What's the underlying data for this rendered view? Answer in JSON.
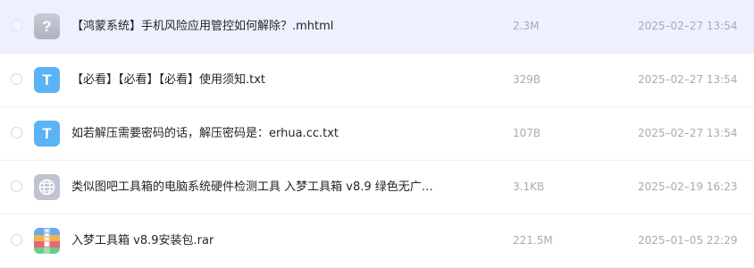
{
  "files": [
    {
      "icon": "unknown-file-icon",
      "icon_glyph": "?",
      "name": "【鸿蒙系统】手机风险应用管控如何解除？.mhtml",
      "size": "2.3M",
      "date": "2025–02–27 13:54",
      "selected": true
    },
    {
      "icon": "txt-file-icon",
      "icon_glyph": "T",
      "name": "【必看】【必看】【必看】使用须知.txt",
      "size": "329B",
      "date": "2025–02–27 13:54",
      "selected": false
    },
    {
      "icon": "txt-file-icon",
      "icon_glyph": "T",
      "name": "如若解压需要密码的话，解压密码是：erhua.cc.txt",
      "size": "107B",
      "date": "2025–02–27 13:54",
      "selected": false
    },
    {
      "icon": "globe-file-icon",
      "name": "类似图吧工具箱的电脑系统硬件检测工具 入梦工具箱 v8.9 绿色无广…",
      "size": "3.1KB",
      "date": "2025–02–19 16:23",
      "selected": false
    },
    {
      "icon": "archive-file-icon",
      "name": "入梦工具箱 v8.9安装包.rar",
      "size": "221.5M",
      "date": "2025–01–05 22:29",
      "selected": false
    }
  ],
  "colors": {
    "selected_row": "#eef1fd",
    "txt_icon": "#5ab3f5",
    "unknown_icon": "#b9bdc9",
    "muted_text": "#a6abb5",
    "name_text": "#1f2329"
  }
}
